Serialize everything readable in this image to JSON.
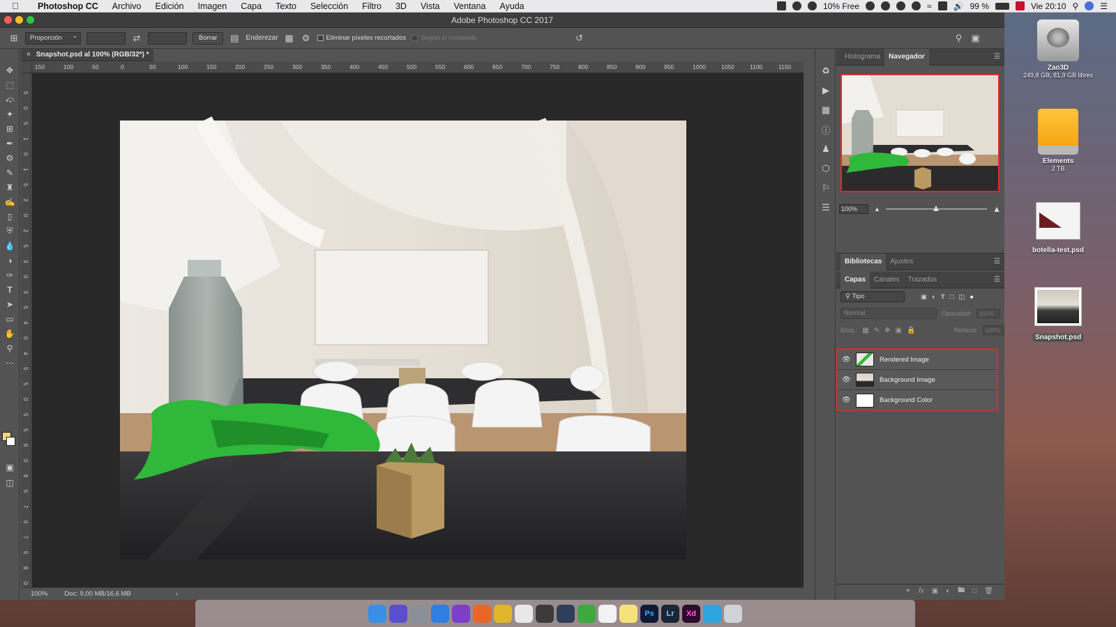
{
  "menubar": {
    "app_name": "Photoshop CC",
    "items": [
      "Archivo",
      "Edición",
      "Imagen",
      "Capa",
      "Texto",
      "Selección",
      "Filtro",
      "3D",
      "Vista",
      "Ventana",
      "Ayuda"
    ],
    "memory": "10% Free",
    "battery": "99 %",
    "clock": "Vie 20:10"
  },
  "window": {
    "title": "Adobe Photoshop CC 2017"
  },
  "options": {
    "ratio_select": "Proporción",
    "clear_button": "Borrar",
    "straighten_label": "Enderezar",
    "delete_cropped": "Eliminar píxeles recortados",
    "content_aware": "Según el contenido"
  },
  "document": {
    "tab_title": "Snapshot.psd al 100% (RGB/32*) *",
    "ruler_ticks": [
      "150",
      "100",
      "50",
      "0",
      "50",
      "100",
      "150",
      "200",
      "250",
      "300",
      "350",
      "400",
      "450",
      "500",
      "550",
      "600",
      "650",
      "700",
      "750",
      "800",
      "850",
      "900",
      "950",
      "1000",
      "1050",
      "1100",
      "1150"
    ],
    "ruler_ticks_v": [
      "5",
      "0",
      "5",
      "1",
      "0",
      "1",
      "5",
      "2",
      "0",
      "2",
      "5",
      "3",
      "0",
      "3",
      "5",
      "4",
      "0",
      "4",
      "5",
      "5",
      "0",
      "5",
      "5",
      "6",
      "0",
      "6",
      "5",
      "7",
      "0",
      "7",
      "5",
      "8",
      "0"
    ],
    "zoom": "100%",
    "doc_info": "Doc: 9,00 MB/16,6 MB"
  },
  "navigator": {
    "tabs": [
      "Histograma",
      "Navegador"
    ],
    "zoom": "100%"
  },
  "libraries": {
    "tabs": [
      "Bibliotecas",
      "Ajustes"
    ]
  },
  "layers": {
    "tabs": [
      "Capas",
      "Canales",
      "Trazados"
    ],
    "filter": "Tipo",
    "blend_mode": "Normal",
    "opacity_label": "Opacidad:",
    "opacity_value": "100%",
    "lock_label": "Bloq.:",
    "fill_label": "Relleno:",
    "fill_value": "100%",
    "items": [
      {
        "name": "Rendered Image"
      },
      {
        "name": "Background Image"
      },
      {
        "name": "Background Color"
      }
    ]
  },
  "desktop": {
    "icons": [
      {
        "name": "Zao3D",
        "sub": "249,8 GB, 81,9 GB libres"
      },
      {
        "name": "Elements",
        "sub": "2 TB"
      },
      {
        "name": "botella-test.psd",
        "sub": ""
      },
      {
        "name": "Snapshot.psd",
        "sub": ""
      }
    ]
  },
  "dock": {
    "apps": [
      {
        "label": "Finder",
        "color": "#3a8ee6"
      },
      {
        "label": "Siri",
        "color": "#5b4fcf"
      },
      {
        "label": "Launchpad",
        "color": "#8a8f99"
      },
      {
        "label": "Safari",
        "color": "#2f7fe0"
      },
      {
        "label": "Siri Remote",
        "color": "#7b3fc9"
      },
      {
        "label": "Firefox",
        "color": "#e8662a"
      },
      {
        "label": "Chrome",
        "color": "#e0b62a"
      },
      {
        "label": "Evernote",
        "color": "#e8e8e8"
      },
      {
        "label": "Sublime",
        "color": "#3b3b3b"
      },
      {
        "label": "Mission",
        "color": "#2f3f5a"
      },
      {
        "label": "Leaf",
        "color": "#3fa83f"
      },
      {
        "label": "Calendar",
        "color": "#f2f2f2"
      },
      {
        "label": "Notes",
        "color": "#f6e27a"
      },
      {
        "label": "Ps",
        "color": "#0e1a33"
      },
      {
        "label": "Lr",
        "color": "#1a2636"
      },
      {
        "label": "Xd",
        "color": "#2e0a2b"
      },
      {
        "label": "Telegram",
        "color": "#2ca5e0"
      },
      {
        "label": "Trash",
        "color": "#cfd3d8"
      }
    ]
  }
}
